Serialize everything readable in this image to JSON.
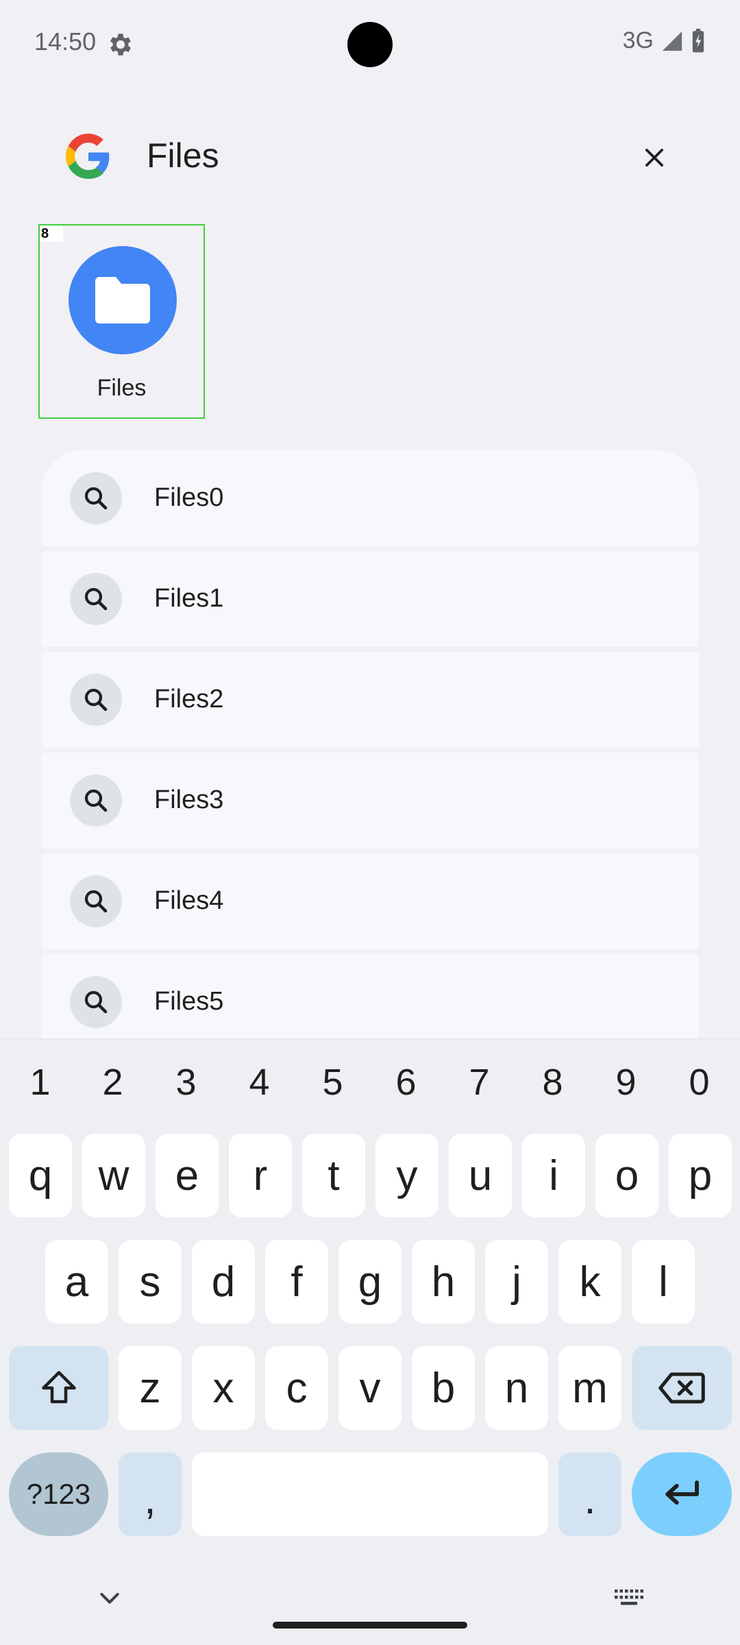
{
  "status_bar": {
    "time": "14:50",
    "network": "3G"
  },
  "search": {
    "query": "Files"
  },
  "app_result": {
    "badge": "8",
    "label": "Files",
    "icon": "folder-icon",
    "color": "#4285f4"
  },
  "suggestions": [
    {
      "label": "Files0"
    },
    {
      "label": "Files1"
    },
    {
      "label": "Files2"
    },
    {
      "label": "Files3"
    },
    {
      "label": "Files4"
    },
    {
      "label": "Files5"
    }
  ],
  "keyboard": {
    "numbers": [
      "1",
      "2",
      "3",
      "4",
      "5",
      "6",
      "7",
      "8",
      "9",
      "0"
    ],
    "row1": [
      "q",
      "w",
      "e",
      "r",
      "t",
      "y",
      "u",
      "i",
      "o",
      "p"
    ],
    "row2": [
      "a",
      "s",
      "d",
      "f",
      "g",
      "h",
      "j",
      "k",
      "l"
    ],
    "row3": [
      "z",
      "x",
      "c",
      "v",
      "b",
      "n",
      "m"
    ],
    "symbols_label": "?123",
    "comma": ",",
    "period": "."
  }
}
